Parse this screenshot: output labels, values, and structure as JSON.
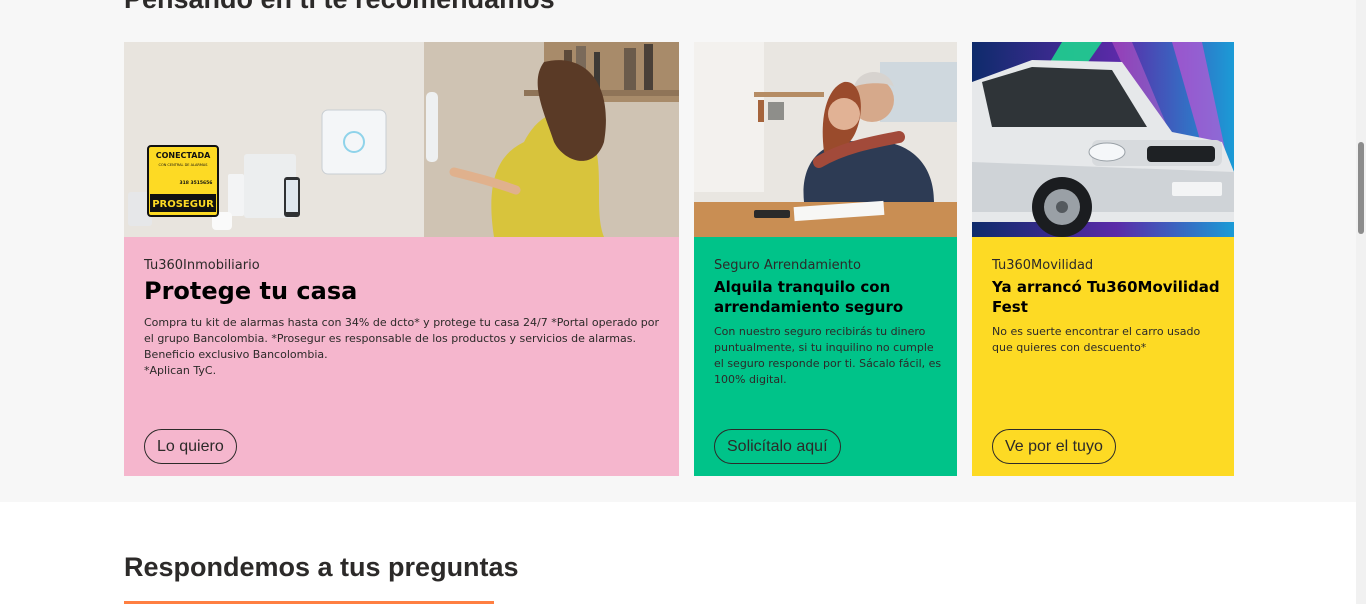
{
  "top_section": {
    "title": "Pensando en ti te recomendamos"
  },
  "cards": [
    {
      "eyebrow": "Tu360Inmobiliario",
      "title": "Protege tu casa",
      "description": "Compra tu kit de alarmas hasta con 34% de dcto* y protege tu casa 24/7 *Portal operado por el grupo Bancolombia. *Prosegur es responsable de los productos y servicios de alarmas. Beneficio exclusivo Bancolombia.",
      "note": "*Aplican TyC.",
      "cta": "Lo quiero",
      "color": "#f5b6cd",
      "image_text": {
        "sign_line1": "CONECTADA",
        "sign_line2": "CON CENTRAL DE ALARMAS",
        "sign_phone": "318 3515656",
        "sign_brand": "PROSEGUR"
      }
    },
    {
      "eyebrow": "Seguro Arrendamiento",
      "title": "Alquila tranquilo con arrendamiento seguro",
      "description": "Con nuestro seguro recibirás tu dinero puntualmente, si tu inquilino no cumple el seguro responde por ti. Sácalo fácil, es 100% digital.",
      "cta": "Solicítalo aquí",
      "color": "#00c389"
    },
    {
      "eyebrow": "Tu360Movilidad",
      "title": "Ya arrancó Tu360Movilidad Fest",
      "description": "No es suerte encontrar el carro usado que quieres con descuento*",
      "cta": "Ve por el tuyo",
      "color": "#fdda24"
    }
  ],
  "faq": {
    "title": "Respondemos a tus preguntas",
    "accent": "#ff7f41"
  }
}
